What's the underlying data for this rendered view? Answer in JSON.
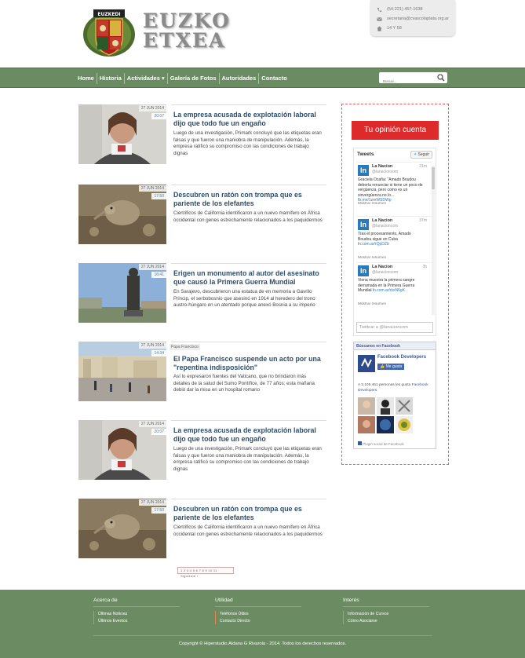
{
  "brand": {
    "line1": "EUZKO",
    "line2": "ETXEA",
    "shield_text": "EUZKEDI"
  },
  "contact": {
    "phone": "(54-221) 457-1638",
    "email": "secretaria@cvascolaplata.org.ar",
    "address": "14 Y 58"
  },
  "nav": {
    "items": [
      "Home",
      "Historia",
      "Actividades ▾",
      "Galería de Fotos",
      "Autoridades",
      "Contacto"
    ],
    "search_placeholder": "Buscar..."
  },
  "articles": [
    {
      "date": "27 JUN 2014",
      "time": "20:07",
      "tag": "",
      "title": "La empresa acusada de explotación laboral dijo que todo fue un engaño",
      "excerpt": "Luego de una investigación, Primark concluyó que las etiquetas eran falsas y que fueron una maniobra de manipulación. Además, la empresa ratificó su compromiso con las condiciones de trabajo dignas",
      "image": "girl"
    },
    {
      "date": "27 JUN 2014",
      "time": "17:50",
      "tag": "",
      "title": "Descubren un ratón con trompa que es pariente de los elefantes",
      "excerpt": "Científicos de California identificaron a un nuevo mamífero en África occidental con genes estrechamente relacionados a los paquidermos",
      "image": "mouse"
    },
    {
      "date": "27 JUN 2014",
      "time": "16:41",
      "tag": "",
      "title": "Erigen un monumento al autor del asesinato que causó la Primera Guerra Mundial",
      "excerpt": "En Sarajevo, descubrieron una estatua de en memoria a Gavrilo Princip, el serbobosnio que asesinó en 1914 al heredero del trono austro-húngaro en un atentado porque anexó Bosnia a su imperio",
      "image": "statue"
    },
    {
      "date": "27 JUN 2014",
      "time": "14:34",
      "tag": "Papa Francisco",
      "title": "El Papa Francisco suspende un acto por una \"repentina indisposición\"",
      "excerpt": "Así lo expresaron fuentes del Vaticano, que no brindaron más detalles de la salud del Sumo Pontífice, de 77 años; esta mañana debió dar la misa en un hospital romano",
      "image": "square"
    },
    {
      "date": "27 JUN 2014",
      "time": "20:07",
      "tag": "",
      "title": "La empresa acusada de explotación laboral dijo que todo fue un engaño",
      "excerpt": "Luego de una investigación, Primark concluyó que las etiquetas eran falsas y que fueron una maniobra de manipulación. Además, la empresa ratificó su compromiso con las condiciones de trabajo dignas",
      "image": "girl"
    },
    {
      "date": "27 JUN 2014",
      "time": "17:50",
      "tag": "",
      "title": "Descubren un ratón con trompa que es pariente de los elefantes",
      "excerpt": "Científicos de California identificaron a un nuevo mamífero en África occidental con genes estrechamente relacionados a los paquidermos",
      "image": "mouse"
    }
  ],
  "pagination": {
    "label": "1 2 3 4 5 6 7 8 9 10 11  Siguiente ›"
  },
  "sidebar": {
    "opinion_button": "Tu opinión cuenta",
    "tweets": {
      "header": "Tweets",
      "follow": "Seguir",
      "compose_placeholder": "Twittear a @lanacioncom",
      "items": [
        {
          "name": "La Nacion",
          "handle": "@lanacioncom",
          "ago": "21m",
          "text": "Graciela Ocaña: \"Amado Boudou debería renunciar si tiene un poco de vergüenza, pero como es un sinvergüenza no lo...",
          "link": "fb.me/1zmWSDWp",
          "summary": "Mostrar resumen"
        },
        {
          "name": "La Nacion",
          "handle": "@lanacioncom",
          "ago": "37m",
          "text": "Tras el procesamiento, Amado Boudou sigue en Cuba",
          "link": "ln.com.ar/rQpDZb",
          "summary": "Mostrar resumen"
        },
        {
          "name": "La Nacion",
          "handle": "@lanacioncom",
          "ago": "3h",
          "text": "Viena muestra la primera sangre derramada en la Primera Guerra Mundial",
          "link": "ln.com.ar/rkxN6gK",
          "summary": "Mostrar resumen"
        }
      ]
    },
    "facebook": {
      "header": "Búscanos en Facebook",
      "page_name": "Facebook Developers",
      "like_label": "Me gusta",
      "count_text": "A 3.105.461 personas les gusta",
      "count_link": "Facebook Developers.",
      "plugin_label": "Plugin social de Facebook"
    }
  },
  "footer": {
    "columns": [
      {
        "title": "Acerca de",
        "links": [
          "Últimas Noticias",
          "Últimos Eventos"
        ]
      },
      {
        "title": "Utilidad",
        "links": [
          "Teléfonos Útiles",
          "Contacto Directo"
        ]
      },
      {
        "title": "Interés",
        "links": [
          "Información de Cursos",
          "Cómo Asociarse"
        ]
      }
    ],
    "copyright": "Copyright © Hiperstudio.Aldana G Rivarola - 2014. Todos los derechos reservados."
  },
  "colors": {
    "nav_green": "#6b8b62",
    "opinion_red": "#dd2a2a",
    "title_blue": "#2d4d6b"
  }
}
